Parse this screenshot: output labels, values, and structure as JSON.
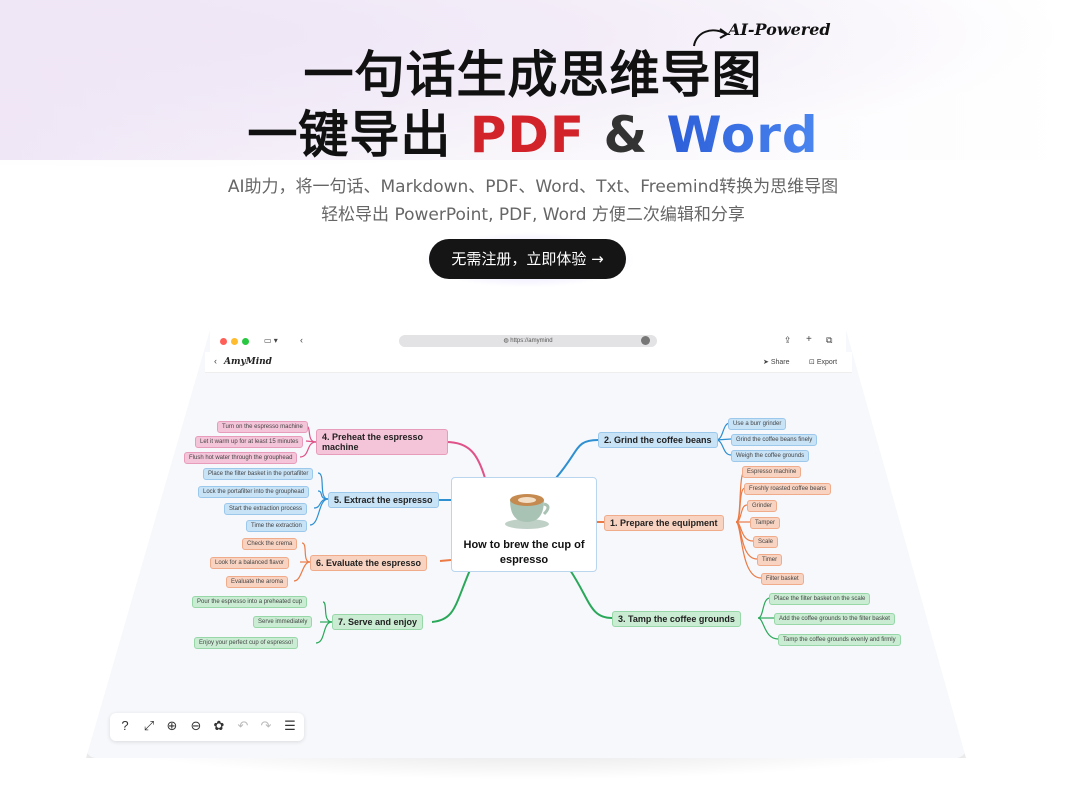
{
  "hero": {
    "title_line1": "一句话生成思维导图",
    "title_line2_prefix": "一键导出 ",
    "title_pdf": "PDF",
    "title_amp": " & ",
    "title_word": "Word",
    "tagline": "AI-Powered",
    "subtitle_line1": "AI助力，将一句话、Markdown、PDF、Word、Txt、Freemind转换为思维导图",
    "subtitle_line2": "轻松导出 PowerPoint, PDF, Word 方便二次编辑和分享",
    "cta_label": "无需注册，立即体验 →"
  },
  "browser": {
    "url": "https://amymind",
    "app_name": "AmyMind",
    "share_label": "Share",
    "export_label": "Export"
  },
  "mindmap": {
    "center": "How to brew the cup of espresso",
    "branches": [
      {
        "label": "2. Grind the coffee beans",
        "items": [
          "Use a burr grinder",
          "Grind the coffee beans finely",
          "Weigh the coffee grounds"
        ]
      },
      {
        "label": "1. Prepare the equipment",
        "items": [
          "Espresso machine",
          "Freshly roasted coffee beans",
          "Grinder",
          "Tamper",
          "Scale",
          "Timer",
          "Filter basket"
        ]
      },
      {
        "label": "3. Tamp the coffee grounds",
        "items": [
          "Place the filter basket on the scale",
          "Add the coffee grounds to the filter basket",
          "Tamp the coffee grounds evenly and firmly"
        ]
      },
      {
        "label": "4. Preheat the espresso machine",
        "items": [
          "Turn on the espresso machine",
          "Let it warm up for at least 15 minutes",
          "Flush hot water through the grouphead"
        ]
      },
      {
        "label": "5. Extract the espresso",
        "items": [
          "Place the filter basket in the portafilter",
          "Lock the portafilter into the grouphead",
          "Start the extraction process",
          "Time the extraction"
        ]
      },
      {
        "label": "6. Evaluate the espresso",
        "items": [
          "Check the crema",
          "Look for a balanced flavor",
          "Evaluate the aroma"
        ]
      },
      {
        "label": "7. Serve and enjoy",
        "items": [
          "Pour the espresso into a preheated cup",
          "Serve immediately",
          "Enjoy your perfect cup of espresso!"
        ]
      }
    ]
  },
  "colors": {
    "pdf": "#d2232a",
    "word": "#2c5ed8",
    "cta_bg": "#151515",
    "branch_pink": "#e0528a",
    "branch_blue": "#2e8fd1",
    "branch_orange": "#ec7a45",
    "branch_green": "#2aa85a"
  },
  "toolbar_icons": [
    "help-icon",
    "fit-screen-icon",
    "zoom-in-icon",
    "zoom-out-icon",
    "theme-palette-icon",
    "undo-icon",
    "redo-icon",
    "outline-list-icon"
  ]
}
